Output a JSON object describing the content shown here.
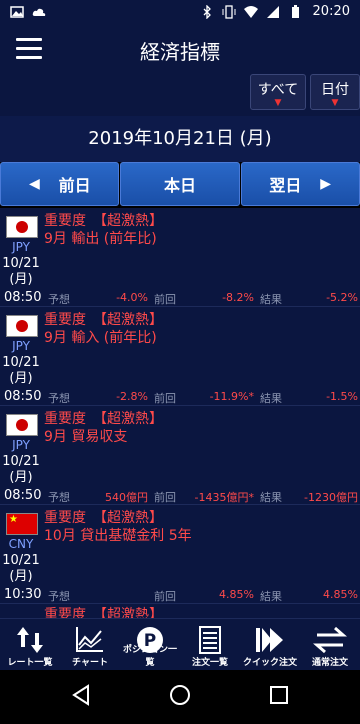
{
  "status_bar": {
    "time": "20:20"
  },
  "app_bar": {
    "title": "経済指標"
  },
  "filters": {
    "all_label": "すべて",
    "date_label": "日付"
  },
  "date_header": "2019年10月21日 (月)",
  "nav": {
    "prev": "前日",
    "today": "本日",
    "next": "翌日"
  },
  "labels": {
    "forecast": "予想",
    "previous": "前回",
    "result": "結果"
  },
  "events": [
    {
      "currency": "JPY",
      "date": "10/21",
      "weekday": "(月)",
      "time": "08:50",
      "importance": "重要度　【超激熱】",
      "name": "9月 輸出 (前年比)",
      "forecast": "-4.0%",
      "previous": "-8.2%",
      "result": "-5.2%",
      "flag": "jp"
    },
    {
      "currency": "JPY",
      "date": "10/21",
      "weekday": "(月)",
      "time": "08:50",
      "importance": "重要度　【超激熱】",
      "name": "9月 輸入 (前年比)",
      "forecast": "-2.8%",
      "previous": "-11.9%*",
      "result": "-1.5%",
      "flag": "jp"
    },
    {
      "currency": "JPY",
      "date": "10/21",
      "weekday": "(月)",
      "time": "08:50",
      "importance": "重要度　【超激熱】",
      "name": "9月 貿易収支",
      "forecast": "540億円",
      "previous": "-1435億円*",
      "result": "-1230億円",
      "flag": "jp"
    },
    {
      "currency": "CNY",
      "date": "10/21",
      "weekday": "(月)",
      "time": "10:30",
      "importance": "重要度　【超激熱】",
      "name": "10月 貸出基礎金利 5年",
      "forecast": "",
      "previous": "4.85%",
      "result": "4.85%",
      "flag": "cn"
    }
  ],
  "partial_row": "重要度　【超激熱】",
  "bottom_nav": [
    {
      "label": "レート一覧",
      "icon": "rate-list-icon"
    },
    {
      "label": "チャート",
      "icon": "chart-icon"
    },
    {
      "label": "ポジション一覧",
      "icon": "position-icon"
    },
    {
      "label": "注文一覧",
      "icon": "order-list-icon"
    },
    {
      "label": "クイック注文",
      "icon": "quick-order-icon"
    },
    {
      "label": "通常注文",
      "icon": "normal-order-icon"
    }
  ],
  "colors": {
    "background": "#0b1640",
    "accent_red": "#ff4a4a",
    "nav_blue": "#1a4fa8"
  }
}
